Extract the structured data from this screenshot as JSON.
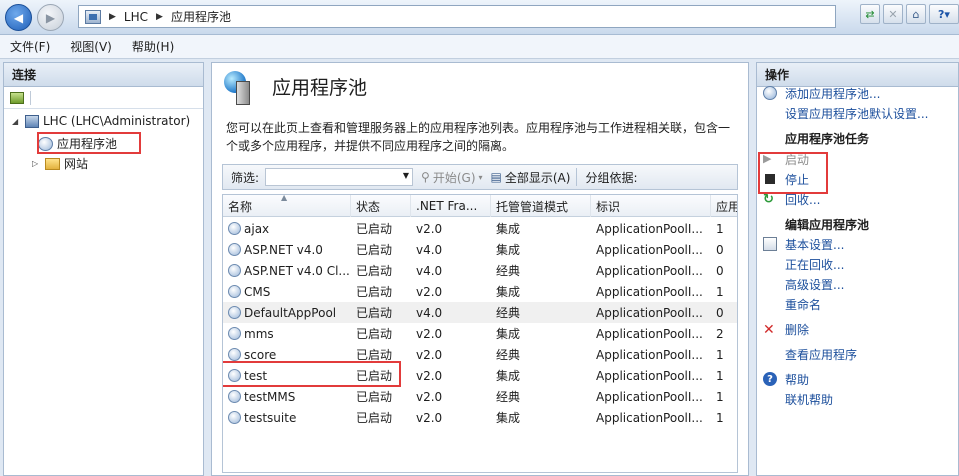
{
  "address": {
    "crumbs": [
      "LHC",
      "应用程序池"
    ]
  },
  "menu": [
    "文件(F)",
    "视图(V)",
    "帮助(H)"
  ],
  "left": {
    "title": "连接",
    "tree": {
      "root": "LHC (LHC\\Administrator)",
      "app_pools": "应用程序池",
      "sites": "网站"
    }
  },
  "center": {
    "title": "应用程序池",
    "description": "您可以在此页上查看和管理服务器上的应用程序池列表。应用程序池与工作进程相关联，包含一个或多个应用程序，并提供不同应用程序之间的隔离。",
    "filter": {
      "label": "筛选:",
      "start": "开始(G)",
      "show_all": "全部显示(A)",
      "group_by": "分组依据:"
    },
    "columns": [
      "名称",
      "状态",
      ".NET Fra...",
      "托管管道模式",
      "标识",
      "应用"
    ],
    "rows": [
      {
        "name": "ajax",
        "status": "已启动",
        "net": "v2.0",
        "mode": "集成",
        "identity": "ApplicationPoolI...",
        "apps": "1"
      },
      {
        "name": "ASP.NET v4.0",
        "status": "已启动",
        "net": "v4.0",
        "mode": "集成",
        "identity": "ApplicationPoolI...",
        "apps": "0"
      },
      {
        "name": "ASP.NET v4.0 Cl...",
        "status": "已启动",
        "net": "v4.0",
        "mode": "经典",
        "identity": "ApplicationPoolI...",
        "apps": "0"
      },
      {
        "name": "CMS",
        "status": "已启动",
        "net": "v2.0",
        "mode": "集成",
        "identity": "ApplicationPoolI...",
        "apps": "1"
      },
      {
        "name": "DefaultAppPool",
        "status": "已启动",
        "net": "v4.0",
        "mode": "经典",
        "identity": "ApplicationPoolI...",
        "apps": "0"
      },
      {
        "name": "mms",
        "status": "已启动",
        "net": "v2.0",
        "mode": "集成",
        "identity": "ApplicationPoolI...",
        "apps": "2"
      },
      {
        "name": "score",
        "status": "已启动",
        "net": "v2.0",
        "mode": "经典",
        "identity": "ApplicationPoolI...",
        "apps": "1"
      },
      {
        "name": "test",
        "status": "已启动",
        "net": "v2.0",
        "mode": "集成",
        "identity": "ApplicationPoolI...",
        "apps": "1"
      },
      {
        "name": "testMMS",
        "status": "已启动",
        "net": "v2.0",
        "mode": "经典",
        "identity": "ApplicationPoolI...",
        "apps": "1"
      },
      {
        "name": "testsuite",
        "status": "已启动",
        "net": "v2.0",
        "mode": "集成",
        "identity": "ApplicationPoolI...",
        "apps": "1"
      }
    ]
  },
  "actions": {
    "title": "操作",
    "add_pool": "添加应用程序池...",
    "set_defaults": "设置应用程序池默认设置...",
    "pool_tasks_head": "应用程序池任务",
    "start": "启动",
    "stop": "停止",
    "recycle": "回收...",
    "edit_head": "编辑应用程序池",
    "basic_settings": "基本设置...",
    "recycling": "正在回收...",
    "advanced_settings": "高级设置...",
    "rename": "重命名",
    "delete": "删除",
    "view_apps": "查看应用程序",
    "help": "帮助",
    "online_help": "联机帮助"
  },
  "colors": {
    "highlight_box": "#e23b3b",
    "link": "#1c4f9c"
  }
}
